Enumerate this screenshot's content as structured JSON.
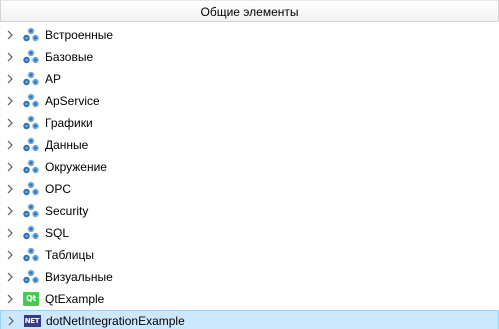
{
  "header": {
    "title": "Общие элементы"
  },
  "tree": {
    "items": [
      {
        "label": "Встроенные",
        "icon": "library-icon"
      },
      {
        "label": "Базовые",
        "icon": "library-icon"
      },
      {
        "label": "AP",
        "icon": "library-icon"
      },
      {
        "label": "ApService",
        "icon": "library-icon"
      },
      {
        "label": "Графики",
        "icon": "library-icon"
      },
      {
        "label": "Данные",
        "icon": "library-icon"
      },
      {
        "label": "Окружение",
        "icon": "library-icon"
      },
      {
        "label": "OPC",
        "icon": "library-icon"
      },
      {
        "label": "Security",
        "icon": "library-icon"
      },
      {
        "label": "SQL",
        "icon": "library-icon"
      },
      {
        "label": "Таблицы",
        "icon": "library-icon"
      },
      {
        "label": "Визуальные",
        "icon": "library-icon"
      },
      {
        "label": "QtExample",
        "icon": "qt-icon",
        "badge": "Qt"
      },
      {
        "label": "dotNetIntegrationExample",
        "icon": "dotnet-icon",
        "badge": "NET",
        "selected": true
      }
    ]
  },
  "colors": {
    "library_icon_light": "#6fa8dc",
    "library_icon_dark": "#2f6fae",
    "qt_green": "#41cd52",
    "dotnet_blue": "#3a3a8c",
    "selection_bg": "#cce8ff",
    "selection_border": "#99d1ff"
  }
}
